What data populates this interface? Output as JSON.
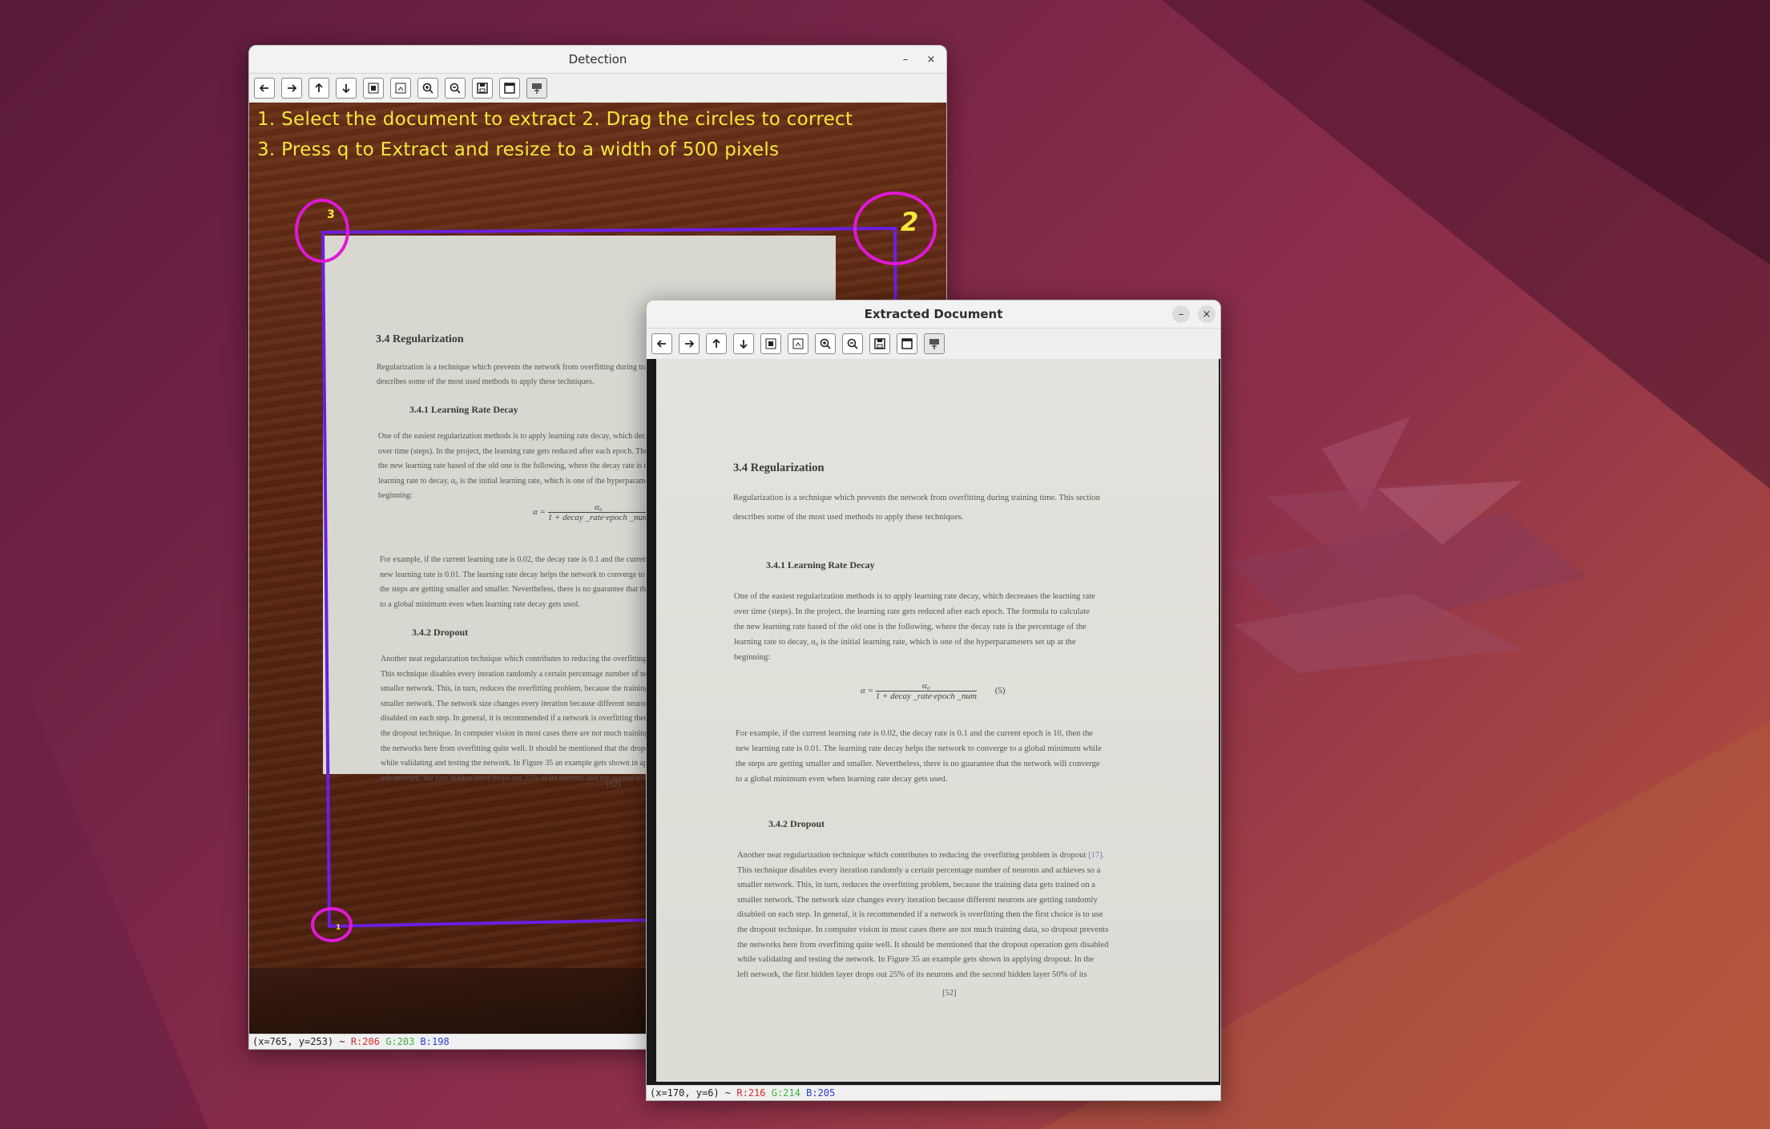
{
  "detection_window": {
    "title": "Detection",
    "minimize": "–",
    "close": "×",
    "instructions": {
      "line1": "1. Select the document to extract   2. Drag the circles to correct",
      "line2": "3. Press q to Extract and resize to a width of 500 pixels"
    },
    "corner_labels": {
      "c1": "1",
      "c2": "2",
      "c3": "3"
    },
    "status": {
      "coords": "(x=765, y=253) ~ ",
      "r": "R:206",
      "g": "G:203",
      "b": "B:198"
    }
  },
  "extracted_window": {
    "title": "Extracted Document",
    "minimize": "–",
    "close": "×",
    "status": {
      "coords": "(x=170, y=6) ~ ",
      "r": "R:216",
      "g": "G:214",
      "b": "B:205"
    }
  },
  "toolbar_icons": [
    "arrow-left-icon",
    "arrow-right-icon",
    "arrow-up-icon",
    "arrow-down-icon",
    "zoom-fit-icon",
    "zoom-original-icon",
    "zoom-in-icon",
    "zoom-out-icon",
    "save-icon",
    "properties-icon",
    "overlay-icon"
  ],
  "document": {
    "heading": "3.4 Regularization",
    "intro": [
      "Regularization is a technique which prevents the network from overfitting during training time. This section",
      "describes some of the most used methods to apply these techniques."
    ],
    "sub1": "3.4.1 Learning Rate Decay",
    "para1": [
      "One of the easiest regularization methods is to apply learning rate decay, which decreases the learning rate",
      "over time (steps). In the project, the learning rate gets reduced after each epoch. The formula to calculate",
      "the new learning rate based of the old one is the following, where the decay rate is the percentage of the",
      "learning rate to decay, α₀ is the initial learning rate, which is one of the hyperparameters set up at the",
      "beginning:"
    ],
    "eq_num": "α₀",
    "eq_lhs": "α =",
    "eq_den": "1 + decay _rate·epoch _num",
    "eq_label": "(5)",
    "para2": [
      "For example, if the current learning rate is 0.02, the decay rate is 0.1 and the current epoch is 10, then the",
      "new learning rate is 0.01. The learning rate decay helps the network to converge to a global minimum while",
      "the steps are getting smaller and smaller. Nevertheless, there is no guarantee that the network will converge",
      "to a global minimum even when learning rate decay gets used."
    ],
    "sub2": "3.4.2 Dropout",
    "para3": [
      "Another neat regularization technique which contributes to reducing the overfitting problem is dropout",
      "This technique disables every iteration randomly a certain percentage number of neurons and achieves so a",
      "smaller network. This, in turn, reduces the overfitting problem, because the training data gets trained on a",
      "smaller network. The network size changes every iteration because different neurons are getting randomly",
      "disabled on each step. In general, it is recommended if a network is overfitting then the first choice is to use",
      "the dropout technique. In computer vision in most cases there are not much training data, so dropout prevents",
      "the networks here from overfitting quite well. It should be mentioned that the dropout operation gets disabled",
      "while validating and testing the network. In Figure 35 an example gets shown in applying dropout. In the",
      "left network, the first hidden layer drops out 25% of its neurons and the second hidden layer 50% of its"
    ],
    "ref": "[17].",
    "page": "[52]"
  }
}
